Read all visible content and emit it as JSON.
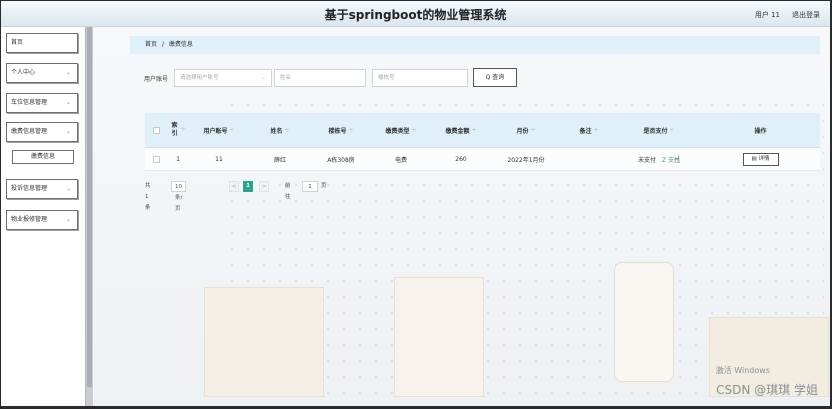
{
  "app": {
    "title": "基于springboot的物业管理系统",
    "user": "用户 11",
    "logout": "退出登录"
  },
  "sidebar": {
    "items": [
      {
        "label": "首页"
      },
      {
        "label": "个人中心",
        "chev": "⌄"
      },
      {
        "label": "车位信息管理",
        "chev": "⌄"
      },
      {
        "label": "缴费信息管理",
        "chev": "⌄"
      },
      {
        "label": "投诉信息管理",
        "chev": "⌄"
      },
      {
        "label": "物业报修管理",
        "chev": "⌄"
      }
    ],
    "sub_item": "缴费信息"
  },
  "breadcrumb": {
    "home": "首页",
    "sep": "/",
    "current": "缴费信息"
  },
  "search": {
    "label": "用户账号",
    "account_placeholder": "请选择用户账号",
    "name_placeholder": "姓名",
    "building_placeholder": "楼栋号",
    "button": "Q 查询"
  },
  "table": {
    "headers": [
      "索引",
      "用户账号",
      "姓名",
      "楼栋号",
      "缴费类型",
      "缴费金额",
      "月份",
      "备注",
      "是否支付",
      "操作"
    ],
    "rows": [
      {
        "index": "1",
        "account": "11",
        "name": "薛红",
        "building": "A栋308房",
        "type": "电费",
        "amount": "260",
        "month": "2022年1月份",
        "note": "",
        "paid": "未支付",
        "pay_action": "Z 支付",
        "detail": "详情"
      }
    ]
  },
  "pager": {
    "total": "共 1 条",
    "page_size": "10条/页",
    "prev": "<",
    "current": "1",
    "next": ">",
    "goto_label": "前往",
    "goto_value": "1",
    "goto_suffix": "页"
  },
  "watermark": {
    "line1": "激活 Windows",
    "line2": "CSDN @琪琪 学姐"
  }
}
